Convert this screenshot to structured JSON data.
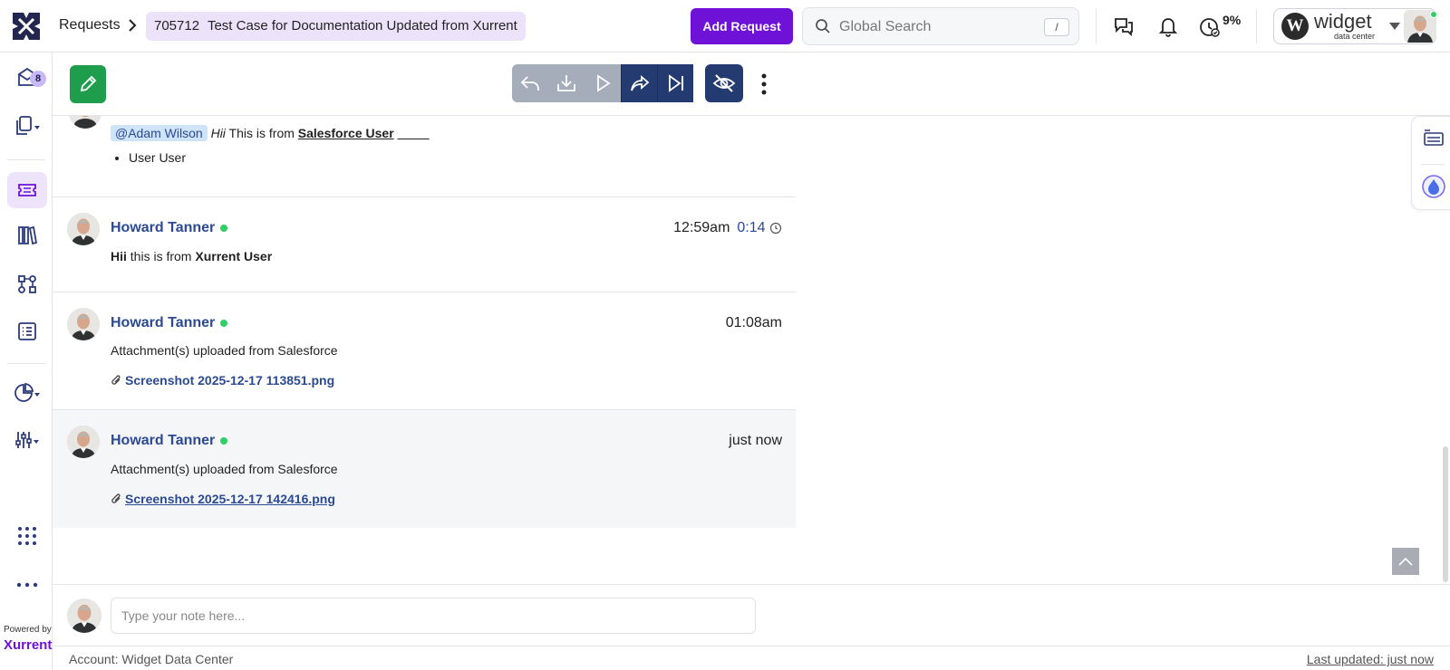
{
  "header": {
    "breadcrumb_root": "Requests",
    "request_number": "705712",
    "request_title": "Test Case for Documentation Updated from Xurrent",
    "add_request_label": "Add Request",
    "search_placeholder": "Global Search",
    "search_shortcut": "/",
    "timer_percent": "9%",
    "account_brand": "widget",
    "account_sub": "data center",
    "brand_color": "#6f12d8"
  },
  "sidebar": {
    "inbox_badge": "8",
    "items": [
      {
        "icon": "inbox-icon"
      },
      {
        "icon": "copy-icon"
      },
      {
        "icon": "ticket-icon",
        "active": true
      },
      {
        "icon": "library-icon"
      },
      {
        "icon": "workflow-icon"
      },
      {
        "icon": "list-icon"
      },
      {
        "icon": "pie-chart-icon"
      },
      {
        "icon": "sliders-icon"
      },
      {
        "icon": "apps-grid-icon"
      },
      {
        "icon": "more-dots-icon"
      }
    ],
    "powered_by": "Powered by",
    "powered_brand": "Xurrent"
  },
  "notes": [
    {
      "mention": "@Adam Wilson",
      "italic": "Hii",
      "text": " This is from ",
      "bold_link": "Salesforce User",
      "trailing": "__ __",
      "bullet": "User User"
    },
    {
      "author": "Howard Tanner",
      "time": "12:59am",
      "tracked": "0:14",
      "bold_1": "Hii",
      "text": " this is from ",
      "bold_2": "Xurrent User"
    },
    {
      "author": "Howard Tanner",
      "time": "01:08am",
      "text": "Attachment(s) uploaded from Salesforce",
      "attachment": "Screenshot 2025-12-17 113851.png"
    },
    {
      "author": "Howard Tanner",
      "time": "just now",
      "text": "Attachment(s) uploaded from Salesforce",
      "attachment": "Screenshot 2025-12-17 142416.png"
    }
  ],
  "compose": {
    "placeholder": "Type your note here..."
  },
  "footer": {
    "account": "Account: Widget Data Center",
    "last_updated": "Last updated: just now"
  }
}
